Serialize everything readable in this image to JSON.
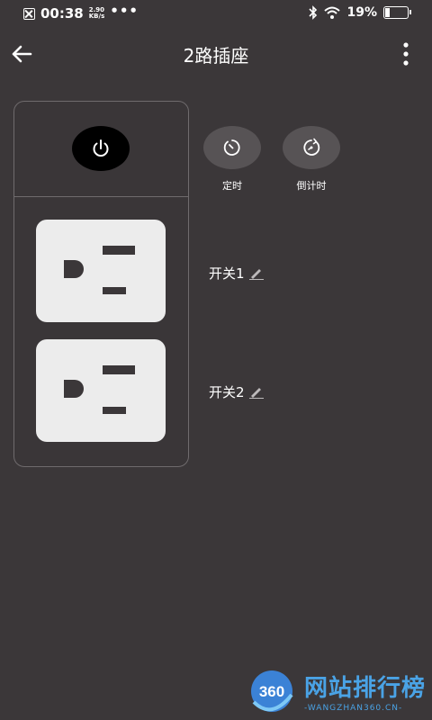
{
  "status_bar": {
    "time": "00:38",
    "net_speed": "2.90",
    "net_unit": "KB/s",
    "more": "•••",
    "battery_percent": "19%",
    "battery_level": 0.19
  },
  "app_bar": {
    "title": "2路插座"
  },
  "actions": {
    "timer_label": "定时",
    "countdown_label": "倒计时"
  },
  "switches": [
    {
      "label": "开关1"
    },
    {
      "label": "开关2"
    }
  ],
  "watermark": {
    "badge": "360",
    "text": "网站排行榜",
    "subtext": "-WANGZHAN360.CN-"
  },
  "colors": {
    "background": "#3b3739",
    "socket": "#ececec",
    "power_button": "#000000",
    "round_button": "#575355",
    "watermark": "#4aa3e6"
  }
}
